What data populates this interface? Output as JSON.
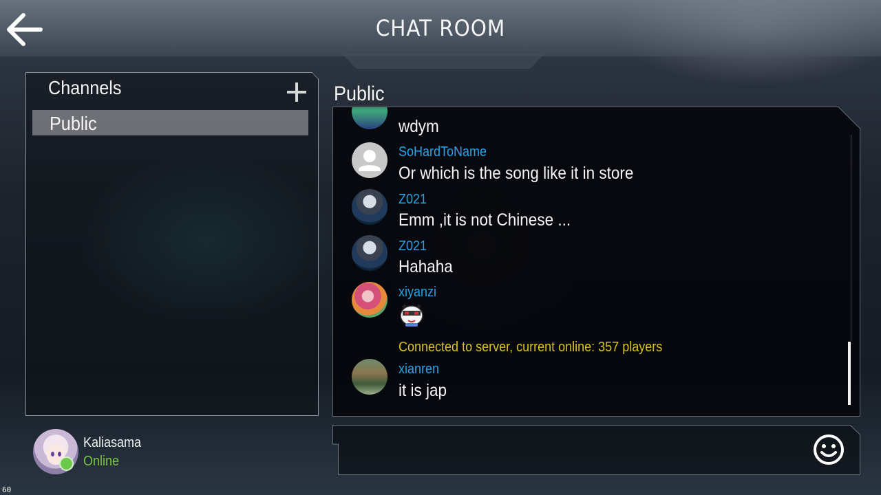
{
  "header": {
    "title": "CHAT ROOM"
  },
  "sidebar": {
    "heading": "Channels",
    "channels": [
      {
        "label": "Public",
        "selected": true
      }
    ]
  },
  "user": {
    "name": "Kaliasama",
    "status": "Online"
  },
  "chat": {
    "channel_title": "Public",
    "messages": [
      {
        "sender": "",
        "text": "wdym"
      },
      {
        "sender": "SoHardToName",
        "text": "Or which is the song like it in store"
      },
      {
        "sender": "Z021",
        "text": "Emm ,it is not Chinese ..."
      },
      {
        "sender": "Z021",
        "text": "Hahaha"
      },
      {
        "sender": "xiyanzi",
        "text": "",
        "sticker": "chibi-sticker"
      }
    ],
    "system_message": "Connected to server, current online: 357 players",
    "last_message": {
      "sender": "xianren",
      "text": "it is jap"
    }
  },
  "input": {
    "placeholder": ""
  },
  "debug": {
    "fps": "60"
  },
  "colors": {
    "sender": "#29a3e6",
    "system": "#d9c51a",
    "online": "#79c43f"
  },
  "icons": {
    "back": "arrow-left-icon",
    "add": "plus-icon",
    "emoji": "smiley-icon",
    "default_avatar": "person-icon"
  }
}
